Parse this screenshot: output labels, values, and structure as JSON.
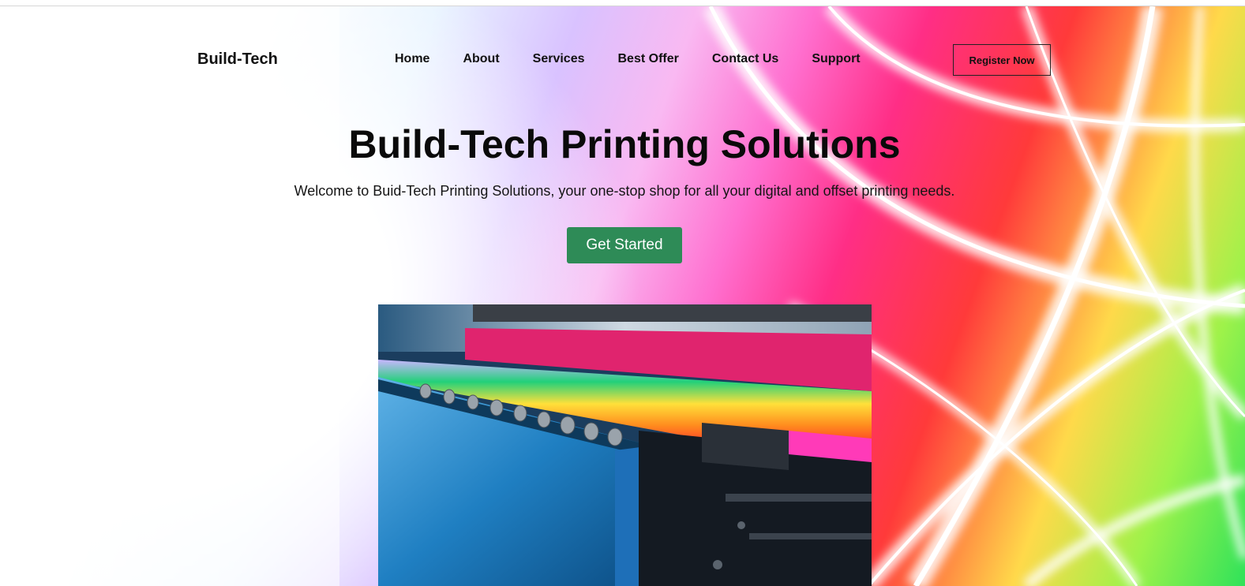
{
  "header": {
    "logo": "Build-Tech",
    "nav": [
      {
        "label": "Home"
      },
      {
        "label": "About"
      },
      {
        "label": "Services"
      },
      {
        "label": "Best Offer"
      },
      {
        "label": "Contact Us"
      },
      {
        "label": "Support"
      }
    ],
    "register_label": "Register Now"
  },
  "hero": {
    "title": "Build-Tech Printing Solutions",
    "subtitle": "Welcome to Buid-Tech Printing Solutions, your one-stop shop for all your digital and offset printing needs.",
    "cta_label": "Get Started",
    "cta_color": "#2e8b57",
    "image": "printing-press-photo"
  }
}
